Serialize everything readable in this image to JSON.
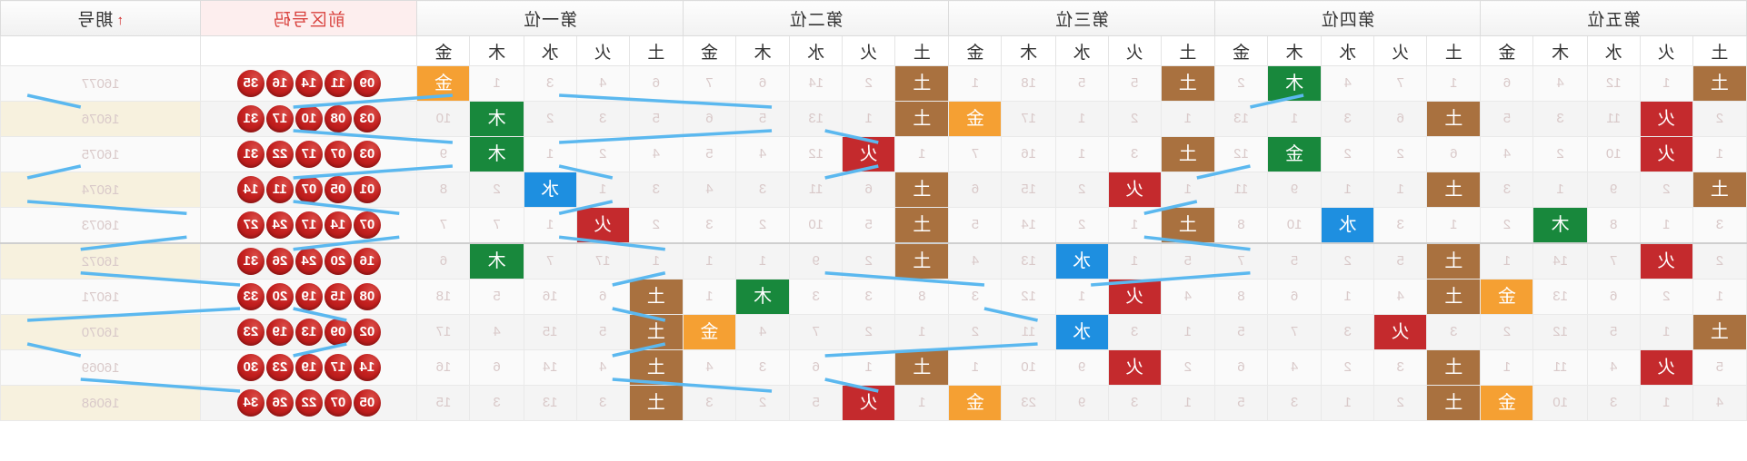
{
  "table": {
    "groups": [
      {
        "label": "第五位",
        "key": "p5"
      },
      {
        "label": "第四位",
        "key": "p4"
      },
      {
        "label": "第三位",
        "key": "p3"
      },
      {
        "label": "第二位",
        "key": "p2"
      },
      {
        "label": "第一位",
        "key": "p1"
      }
    ],
    "elements": [
      "土",
      "火",
      "水",
      "木",
      "金"
    ],
    "front_zone_header": "前区号码",
    "issue_header": "期号",
    "sort_icon": "sort-ascending-arrow",
    "colors": {
      "tu": "#a9713f",
      "huo": "#c42a2d",
      "shui": "#1e8fe0",
      "mu": "#18883c",
      "jin": "#f5a033",
      "ball_red": "#c4201f",
      "front_header_bg": "#fdeeee",
      "front_header_text": "#d9433f",
      "issue_bg": "#faf5e6",
      "miss_text": "#d9c9c9"
    }
  },
  "rows": [
    {
      "issue": "16077",
      "balls": [
        "09",
        "11",
        "14",
        "16",
        "35"
      ],
      "p5": {
        "values": [
          "土",
          "1",
          "12",
          "4",
          "6"
        ],
        "hit": 0
      },
      "p4": {
        "values": [
          "1",
          "7",
          "4",
          "木",
          "2"
        ],
        "hit": 3
      },
      "p3": {
        "values": [
          "土",
          "5",
          "5",
          "18",
          "1"
        ],
        "hit": 0
      },
      "p2": {
        "values": [
          "土",
          "2",
          "14",
          "6",
          "7"
        ],
        "hit": 0
      },
      "p1": {
        "values": [
          "6",
          "4",
          "3",
          "1",
          "金"
        ],
        "hit": 4
      }
    },
    {
      "issue": "16076",
      "balls": [
        "03",
        "08",
        "10",
        "17",
        "31"
      ],
      "p5": {
        "values": [
          "2",
          "火",
          "11",
          "3",
          "5"
        ],
        "hit": 1
      },
      "p4": {
        "values": [
          "土",
          "6",
          "3",
          "1",
          "13"
        ],
        "hit": 0
      },
      "p3": {
        "values": [
          "1",
          "2",
          "1",
          "17",
          "金"
        ],
        "hit": 4
      },
      "p2": {
        "values": [
          "土",
          "1",
          "13",
          "5",
          "6"
        ],
        "hit": 0
      },
      "p1": {
        "values": [
          "5",
          "3",
          "2",
          "木",
          "10"
        ],
        "hit": 3
      }
    },
    {
      "issue": "16075",
      "balls": [
        "03",
        "07",
        "17",
        "22",
        "31"
      ],
      "p5": {
        "values": [
          "1",
          "火",
          "10",
          "2",
          "4"
        ],
        "hit": 1
      },
      "p4": {
        "values": [
          "6",
          "2",
          "2",
          "金",
          "12"
        ],
        "hit": 3
      },
      "p3": {
        "values": [
          "土",
          "3",
          "1",
          "16",
          "7"
        ],
        "hit": 0
      },
      "p2": {
        "values": [
          "1",
          "火",
          "12",
          "4",
          "5"
        ],
        "hit": 1
      },
      "p1": {
        "values": [
          "4",
          "2",
          "1",
          "木",
          "9"
        ],
        "hit": 3
      }
    },
    {
      "issue": "16074",
      "balls": [
        "01",
        "05",
        "07",
        "11",
        "14"
      ],
      "p5": {
        "values": [
          "土",
          "2",
          "9",
          "1",
          "3"
        ],
        "hit": 0
      },
      "p4": {
        "values": [
          "土",
          "1",
          "1",
          "9",
          "11"
        ],
        "hit": 0
      },
      "p3": {
        "values": [
          "1",
          "火",
          "2",
          "15",
          "6"
        ],
        "hit": 1
      },
      "p2": {
        "values": [
          "土",
          "6",
          "11",
          "3",
          "4"
        ],
        "hit": 0
      },
      "p1": {
        "values": [
          "3",
          "1",
          "水",
          "2",
          "8"
        ],
        "hit": 2
      }
    },
    {
      "issue": "16073",
      "balls": [
        "07",
        "14",
        "17",
        "24",
        "27"
      ],
      "p5": {
        "values": [
          "3",
          "1",
          "8",
          "木",
          "2"
        ],
        "hit": 3
      },
      "p4": {
        "values": [
          "1",
          "3",
          "水",
          "10",
          "8"
        ],
        "hit": 2
      },
      "p3": {
        "values": [
          "土",
          "1",
          "2",
          "14",
          "5"
        ],
        "hit": 0
      },
      "p2": {
        "values": [
          "土",
          "5",
          "10",
          "2",
          "3"
        ],
        "hit": 0
      },
      "p1": {
        "values": [
          "2",
          "火",
          "1",
          "7",
          "7"
        ],
        "hit": 1
      }
    },
    {
      "issue": "16072",
      "balls": [
        "16",
        "20",
        "24",
        "26",
        "31"
      ],
      "p5": {
        "values": [
          "2",
          "火",
          "7",
          "14",
          "1"
        ],
        "hit": 1
      },
      "p4": {
        "values": [
          "土",
          "5",
          "2",
          "5",
          "7"
        ],
        "hit": 0
      },
      "p3": {
        "values": [
          "5",
          "1",
          "水",
          "13",
          "4"
        ],
        "hit": 2
      },
      "p2": {
        "values": [
          "土",
          "2",
          "9",
          "1",
          "1"
        ],
        "hit": 0
      },
      "p1": {
        "values": [
          "1",
          "17",
          "7",
          "木",
          "6"
        ],
        "hit": 3
      }
    },
    {
      "issue": "16071",
      "balls": [
        "08",
        "15",
        "19",
        "20",
        "33"
      ],
      "p5": {
        "values": [
          "1",
          "2",
          "6",
          "13",
          "金"
        ],
        "hit": 4
      },
      "p4": {
        "values": [
          "土",
          "4",
          "1",
          "6",
          "8"
        ],
        "hit": 0
      },
      "p3": {
        "values": [
          "4",
          "火",
          "1",
          "12",
          "3"
        ],
        "hit": 1
      },
      "p2": {
        "values": [
          "8",
          "3",
          "3",
          "木",
          "1"
        ],
        "hit": 3
      },
      "p1": {
        "values": [
          "土",
          "6",
          "16",
          "5",
          "18"
        ],
        "hit": 0
      }
    },
    {
      "issue": "16070",
      "balls": [
        "02",
        "09",
        "13",
        "19",
        "23"
      ],
      "p5": {
        "values": [
          "土",
          "1",
          "5",
          "12",
          "2"
        ],
        "hit": 0
      },
      "p4": {
        "values": [
          "3",
          "火",
          "3",
          "7",
          "5"
        ],
        "hit": 1
      },
      "p3": {
        "values": [
          "1",
          "3",
          "水",
          "11",
          "2"
        ],
        "hit": 2
      },
      "p2": {
        "values": [
          "1",
          "2",
          "7",
          "4",
          "金"
        ],
        "hit": 4
      },
      "p1": {
        "values": [
          "土",
          "5",
          "15",
          "4",
          "17"
        ],
        "hit": 0
      }
    },
    {
      "issue": "16069",
      "balls": [
        "14",
        "17",
        "19",
        "23",
        "30"
      ],
      "p5": {
        "values": [
          "5",
          "火",
          "4",
          "11",
          "1"
        ],
        "hit": 1
      },
      "p4": {
        "values": [
          "土",
          "3",
          "2",
          "4",
          "6"
        ],
        "hit": 0
      },
      "p3": {
        "values": [
          "2",
          "火",
          "9",
          "10",
          "1"
        ],
        "hit": 1
      },
      "p2": {
        "values": [
          "土",
          "1",
          "6",
          "3",
          "4"
        ],
        "hit": 0
      },
      "p1": {
        "values": [
          "土",
          "4",
          "14",
          "6",
          "16"
        ],
        "hit": 0
      }
    },
    {
      "issue": "16068",
      "balls": [
        "05",
        "07",
        "22",
        "26",
        "34"
      ],
      "p5": {
        "values": [
          "4",
          "1",
          "3",
          "10",
          "金"
        ],
        "hit": 4
      },
      "p4": {
        "values": [
          "土",
          "2",
          "1",
          "3",
          "5"
        ],
        "hit": 0
      },
      "p3": {
        "values": [
          "1",
          "3",
          "9",
          "23",
          "金"
        ],
        "hit": 4
      },
      "p2": {
        "values": [
          "1",
          "火",
          "5",
          "2",
          "3"
        ],
        "hit": 1
      },
      "p1": {
        "values": [
          "土",
          "3",
          "13",
          "3",
          "15"
        ],
        "hit": 0
      }
    }
  ]
}
